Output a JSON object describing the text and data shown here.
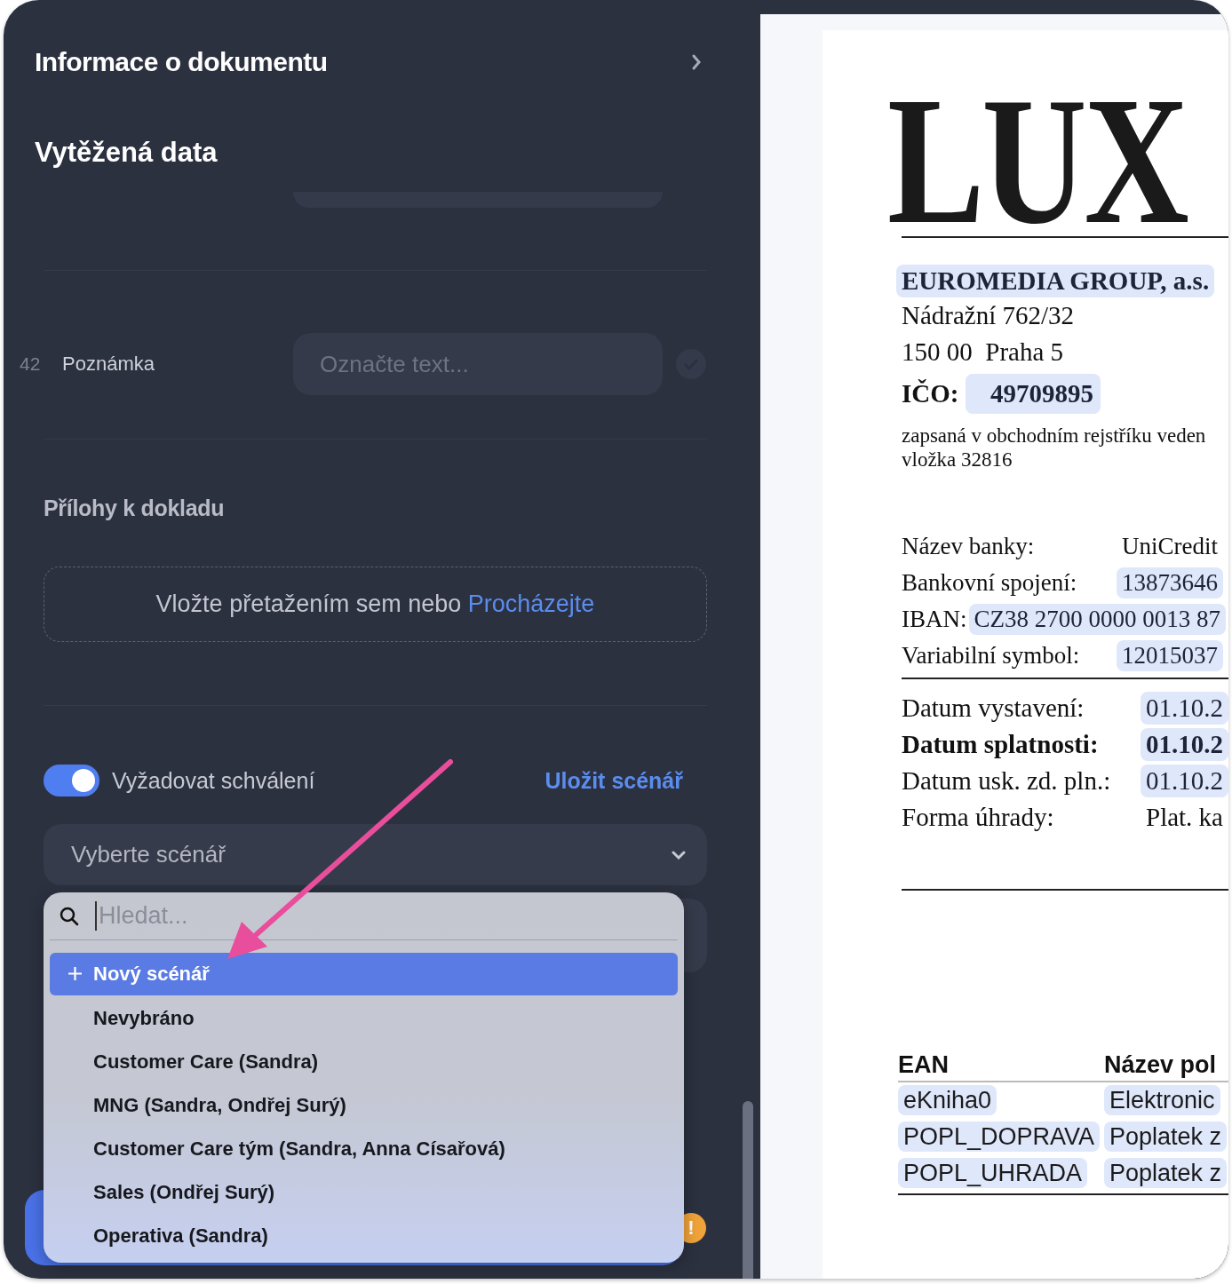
{
  "sidebar": {
    "title": "Informace o dokumentu",
    "section_title": "Vytěžená data",
    "fields": [
      {
        "number": "42",
        "label": "Poznámka",
        "placeholder": "Označte text..."
      }
    ],
    "attachments": {
      "title": "Přílohy k dokladu",
      "dropzone_text": "Vložte přetažením sem nebo",
      "browse_link": "Procházejte"
    },
    "approval": {
      "label": "Vyžadovat schválení",
      "on": true,
      "save_link": "Uložit scénář"
    },
    "scenario_select": {
      "placeholder": "Vyberte scénář"
    },
    "dropdown": {
      "search_placeholder": "Hledat...",
      "items": [
        {
          "label": "Nový scénář",
          "kind": "action",
          "selected": true
        },
        {
          "label": "Nevybráno",
          "kind": "option",
          "selected": false
        },
        {
          "label": "Customer Care (Sandra)",
          "kind": "option",
          "selected": false
        },
        {
          "label": "MNG (Sandra, Ondřej Surý)",
          "kind": "option",
          "selected": false
        },
        {
          "label": "Customer Care tým (Sandra, Anna Císařová)",
          "kind": "option",
          "selected": false
        },
        {
          "label": "Sales (Ondřej Surý)",
          "kind": "option",
          "selected": false
        },
        {
          "label": "Operativa (Sandra)",
          "kind": "option",
          "selected": false
        }
      ]
    },
    "warning_badge": "!"
  },
  "document": {
    "logo": "LUX",
    "company": "EUROMEDIA GROUP, a.s.",
    "address_lines": [
      "Nádražní 762/32",
      "150 00  Praha 5"
    ],
    "ico_label": "IČO:",
    "ico_value": "49709895",
    "registry_lines": [
      "zapsaná v obchodním rejstříku veden",
      "vložka 32816"
    ],
    "bank_rows": [
      {
        "label": "Název banky:",
        "value": "UniCredit",
        "highlighted": false,
        "kind": "column"
      },
      {
        "label": "Bankovní spojení:",
        "value": "13873646",
        "highlighted": true,
        "kind": "column"
      },
      {
        "label": "IBAN:",
        "value": "CZ38 2700 0000 0013 87",
        "highlighted": true,
        "kind": "inline"
      },
      {
        "label": "Variabilní symbol:",
        "value": "12015037",
        "highlighted": true,
        "kind": "column"
      }
    ],
    "date_rows": [
      {
        "label": "Datum vystavení:",
        "value": "01.10.2",
        "highlighted": true,
        "bold": false
      },
      {
        "label": "Datum splatnosti:",
        "value": "01.10.2",
        "highlighted": true,
        "bold": true
      },
      {
        "label": "Datum usk. zd. pln.:",
        "value": "01.10.2",
        "highlighted": true,
        "bold": false
      },
      {
        "label": "Forma úhrady:",
        "value": "Plat. ka",
        "highlighted": false,
        "bold": false
      }
    ],
    "table": {
      "columns": [
        "EAN",
        "Název pol"
      ],
      "rows": [
        [
          "eKniha0",
          "Elektronic"
        ],
        [
          "POPL_DOPRAVA",
          "Poplatek z"
        ],
        [
          "POPL_UHRADA",
          "Poplatek z"
        ]
      ]
    }
  }
}
